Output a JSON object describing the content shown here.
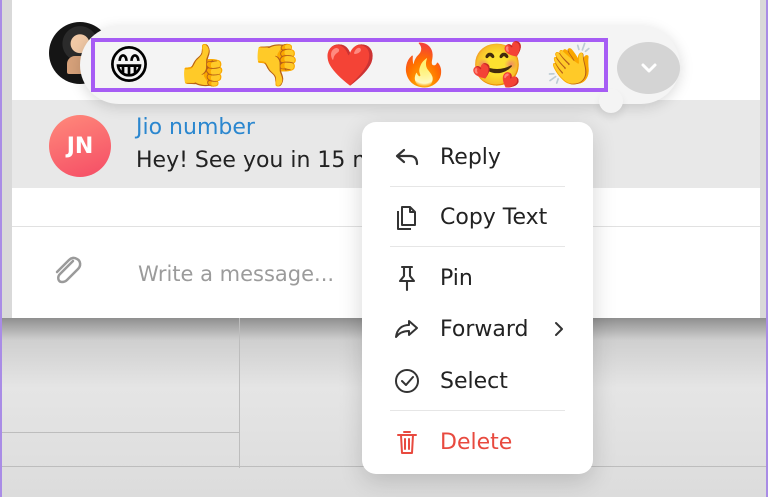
{
  "reactions": {
    "items": [
      {
        "emoji": "😁",
        "name": "grinning-face"
      },
      {
        "emoji": "👍",
        "name": "thumbs-up"
      },
      {
        "emoji": "👎",
        "name": "thumbs-down"
      },
      {
        "emoji": "❤️",
        "name": "red-heart"
      },
      {
        "emoji": "🔥",
        "name": "fire"
      },
      {
        "emoji": "🥰",
        "name": "smiling-face-with-hearts"
      },
      {
        "emoji": "👏",
        "name": "clapping-hands"
      }
    ]
  },
  "message": {
    "avatar_initials": "JN",
    "sender": "Jio number",
    "text": "Hey! See you in 15 m"
  },
  "composer": {
    "placeholder": "Write a message..."
  },
  "menu": {
    "reply": "Reply",
    "copy_text": "Copy Text",
    "pin": "Pin",
    "forward": "Forward",
    "select": "Select",
    "delete": "Delete"
  },
  "colors": {
    "highlight": "#a65cf4",
    "link_blue": "#2b87cf",
    "delete_red": "#e84a3f"
  }
}
